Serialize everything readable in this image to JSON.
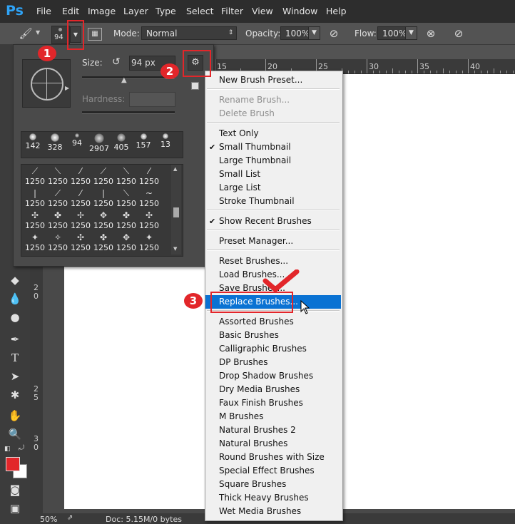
{
  "app": {
    "logo": "Ps"
  },
  "menubar": {
    "items": [
      "File",
      "Edit",
      "Image",
      "Layer",
      "Type",
      "Select",
      "Filter",
      "View",
      "Window",
      "Help"
    ]
  },
  "options": {
    "brush_size_small": "94",
    "mode_label": "Mode:",
    "mode_value": "Normal",
    "opacity_label": "Opacity:",
    "opacity_value": "100%",
    "flow_label": "Flow:",
    "flow_value": "100%"
  },
  "brush_panel": {
    "size_label": "Size:",
    "size_value": "94 px",
    "hardness_label": "Hardness:",
    "recent_sizes": [
      "142",
      "328",
      "94",
      "2907",
      "405",
      "157",
      "13"
    ],
    "preset_value": "1250"
  },
  "menu": {
    "items": [
      {
        "label": "New Brush Preset...",
        "state": "normal"
      },
      {
        "label": "Rename Brush...",
        "state": "disabled"
      },
      {
        "label": "Delete Brush",
        "state": "disabled"
      },
      {
        "label": "Text Only",
        "state": "normal"
      },
      {
        "label": "Small Thumbnail",
        "state": "checked"
      },
      {
        "label": "Large Thumbnail",
        "state": "normal"
      },
      {
        "label": "Small List",
        "state": "normal"
      },
      {
        "label": "Large List",
        "state": "normal"
      },
      {
        "label": "Stroke Thumbnail",
        "state": "normal"
      },
      {
        "label": "Show Recent Brushes",
        "state": "checked"
      },
      {
        "label": "Preset Manager...",
        "state": "normal"
      },
      {
        "label": "Reset Brushes...",
        "state": "normal"
      },
      {
        "label": "Load Brushes...",
        "state": "normal"
      },
      {
        "label": "Save Brushes...",
        "state": "normal"
      },
      {
        "label": "Replace Brushes...",
        "state": "highlighted"
      },
      {
        "label": "Assorted Brushes",
        "state": "normal"
      },
      {
        "label": "Basic Brushes",
        "state": "normal"
      },
      {
        "label": "Calligraphic Brushes",
        "state": "normal"
      },
      {
        "label": "DP Brushes",
        "state": "normal"
      },
      {
        "label": "Drop Shadow Brushes",
        "state": "normal"
      },
      {
        "label": "Dry Media Brushes",
        "state": "normal"
      },
      {
        "label": "Faux Finish Brushes",
        "state": "normal"
      },
      {
        "label": "M Brushes",
        "state": "normal"
      },
      {
        "label": "Natural Brushes 2",
        "state": "normal"
      },
      {
        "label": "Natural Brushes",
        "state": "normal"
      },
      {
        "label": "Round Brushes with Size",
        "state": "normal"
      },
      {
        "label": "Special Effect Brushes",
        "state": "normal"
      },
      {
        "label": "Square Brushes",
        "state": "normal"
      },
      {
        "label": "Thick Heavy Brushes",
        "state": "normal"
      },
      {
        "label": "Wet Media Brushes",
        "state": "normal"
      }
    ]
  },
  "ruler": {
    "h_ticks": [
      "15",
      "20",
      "25",
      "30",
      "35",
      "40"
    ],
    "v_ticks": [
      "2",
      "0",
      "2",
      "5",
      "3",
      "0"
    ]
  },
  "status": {
    "zoom": "50%",
    "doc": "Doc: 5.15M/0 bytes"
  },
  "annotations": [
    "1",
    "2",
    "3"
  ],
  "colors": {
    "accent_highlight": "#0a72d3",
    "annotation_red": "#e2262a",
    "foreground_swatch": "#e2262a",
    "background_swatch": "#ffffff"
  }
}
